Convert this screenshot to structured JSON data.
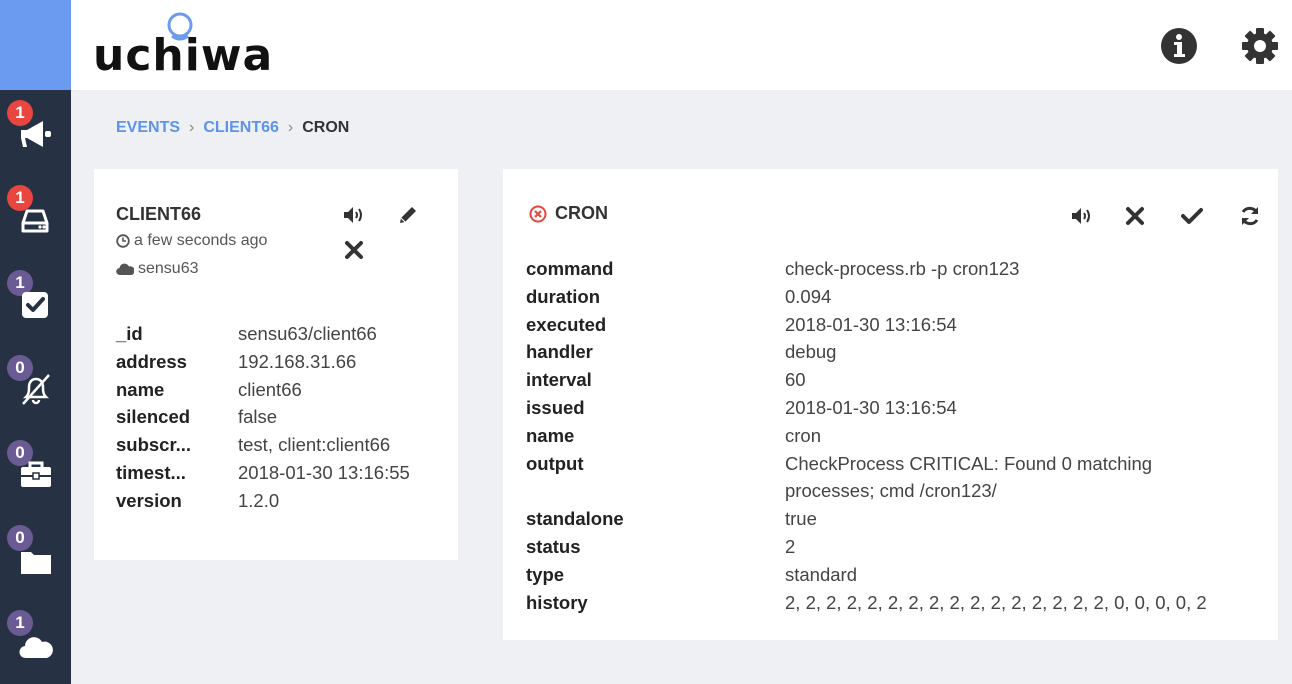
{
  "app": {
    "logo_text": "uchiwa"
  },
  "sidebar": {
    "items": [
      {
        "name": "events",
        "count": "1",
        "icon": "bullhorn-icon",
        "badge_color": "#e8463f"
      },
      {
        "name": "clients",
        "count": "1",
        "icon": "hdd-icon",
        "badge_color": "#e8463f"
      },
      {
        "name": "checks",
        "count": "1",
        "icon": "check-square-icon",
        "badge_color": "#6b5b95"
      },
      {
        "name": "silenced",
        "count": "0",
        "icon": "bell-slash-icon",
        "badge_color": "#6b5b95"
      },
      {
        "name": "stashes",
        "count": "0",
        "icon": "briefcase-icon",
        "badge_color": "#6b5b95"
      },
      {
        "name": "aggregates",
        "count": "0",
        "icon": "folder-icon",
        "badge_color": "#6b5b95"
      },
      {
        "name": "datacenters",
        "count": "1",
        "icon": "cloud-icon",
        "badge_color": "#6b5b95"
      }
    ]
  },
  "header": {
    "info_icon": "info-icon",
    "settings_icon": "gear-icon"
  },
  "breadcrumb": {
    "events": "EVENTS",
    "client": "CLIENT66",
    "check": "CRON"
  },
  "client": {
    "title": "CLIENT66",
    "last_seen": "a few seconds ago",
    "datacenter": "sensu63",
    "fields": [
      {
        "key": "_id",
        "value": "sensu63/client66"
      },
      {
        "key": "address",
        "value": "192.168.31.66"
      },
      {
        "key": "name",
        "value": "client66"
      },
      {
        "key": "silenced",
        "value": "false"
      },
      {
        "key": "subscr...",
        "value": "test, client:client66"
      },
      {
        "key": "timest...",
        "value": "2018-01-30 13:16:55"
      },
      {
        "key": "version",
        "value": "1.2.0"
      }
    ]
  },
  "check": {
    "title": "CRON",
    "status_color": "#e8463f",
    "fields": [
      {
        "key": "command",
        "value": "check-process.rb -p cron123"
      },
      {
        "key": "duration",
        "value": "0.094"
      },
      {
        "key": "executed",
        "value": "2018-01-30 13:16:54"
      },
      {
        "key": "handler",
        "value": "debug"
      },
      {
        "key": "interval",
        "value": "60"
      },
      {
        "key": "issued",
        "value": "2018-01-30 13:16:54"
      },
      {
        "key": "name",
        "value": "cron"
      },
      {
        "key": "output",
        "value": "CheckProcess CRITICAL: Found 0 matching",
        "value2": "processes; cmd /cron123/"
      },
      {
        "key": "standalone",
        "value": "true"
      },
      {
        "key": "status",
        "value": "2"
      },
      {
        "key": "type",
        "value": "standard"
      },
      {
        "key": "history",
        "value": "2, 2, 2, 2, 2, 2, 2, 2, 2, 2, 2, 2, 2, 2, 2, 2, 0, 0, 0, 0, 2"
      }
    ]
  }
}
